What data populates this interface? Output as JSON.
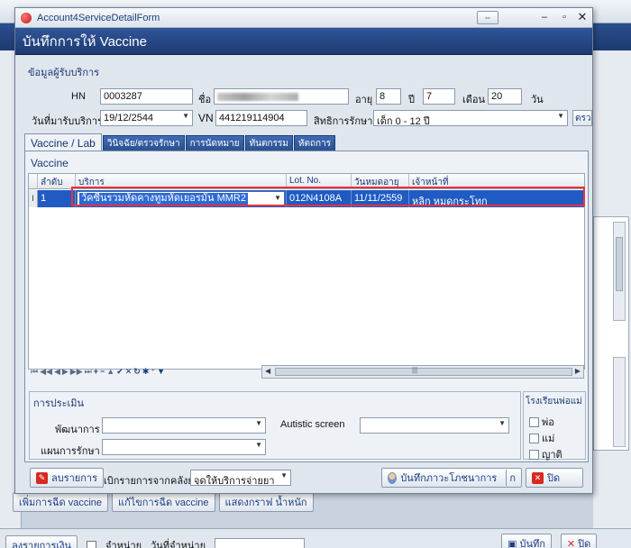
{
  "background": {
    "buttons": [
      "เพิ่มการฉีด vaccine",
      "แก้ไขการฉีด vaccine",
      "แสดงกราฟ น้ำหนัก"
    ],
    "bottom_left_btn": "ลงรายการเงิน",
    "chk_label": "จำหน่าย",
    "date_label": "วันที่จำหน่าย",
    "save_btn": "บันทึก",
    "close_btn": "ปิด"
  },
  "dialog": {
    "window_title": "Account4ServiceDetailForm",
    "header": "บันทึกการให้ Vaccine",
    "patient_section": "ข้อมูลผู้รับบริการ",
    "hn_label": "HN",
    "hn_value": "0003287",
    "name_label": "ชื่อ",
    "age_label": "อายุ",
    "age_value": "8",
    "year_label": "ปี",
    "year_value": "7",
    "month_label": "เดือน",
    "month_value": "20",
    "day_label": "วัน",
    "visit_date_label": "วันที่มารับบริการ",
    "visit_date_value": "19/12/2544",
    "vn_label": "VN",
    "vn_value": "441219114904",
    "right_label": "สิทธิการรักษา",
    "right_value": "เด็ก 0 - 12 ปี",
    "check_btn": "ตรว",
    "tabs": [
      "Vaccine / Lab",
      "วินิจฉัย/ตรวจรักษา",
      "การนัดหมาย",
      "ทันตกรรม",
      "หัตถการ"
    ],
    "vaccine_group": "Vaccine",
    "grid": {
      "columns": [
        "ลำดับ",
        "บริการ",
        "Lot. No.",
        "วันหมดอายุ",
        "เจ้าหน้าที่"
      ],
      "rows": [
        {
          "no": "1",
          "service": "วัคซีนรวมหัดคางทูมหัดเยอรมัน MMR2",
          "lot": "012N4108A",
          "expire": "11/11/2559",
          "staff": "หลิก หมดกระโทก"
        }
      ]
    },
    "assessment_section": "การประเมิน",
    "development_label": "พัฒนาการ",
    "autistic_label": "Autistic screen",
    "plan_label": "แผนการรักษา",
    "school_section": "โรงเรียนพ่อแม่",
    "school_options": [
      "พ่อ",
      "แม่",
      "ญาติ"
    ],
    "delete_btn": "ลบรายการ",
    "billing_label": "เบิกรายการจากคลังย่อย",
    "billing_value": "จุดให้บริการจ่ายยา",
    "nutrition_btn": "บันทึกภาวะโภชนาการ",
    "nutrition_btn2": "ก",
    "close_btn": "ปิด"
  }
}
